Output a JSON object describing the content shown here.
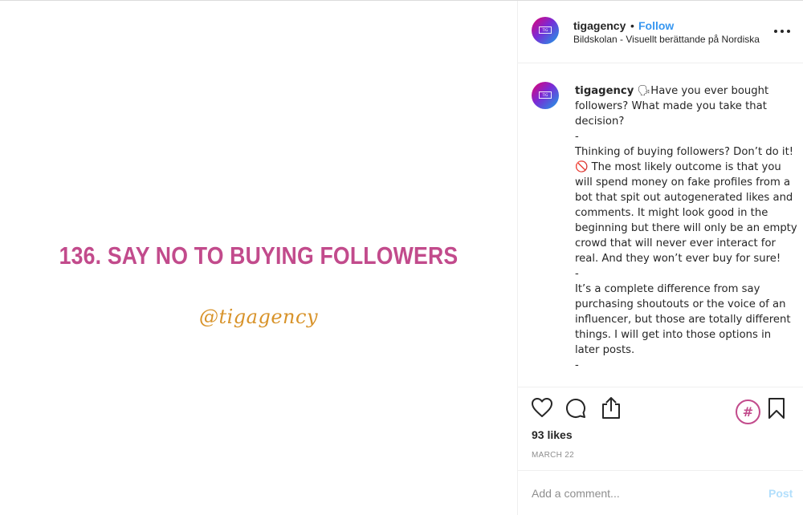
{
  "post": {
    "media": {
      "title": "136. SAY NO TO BUYING FOLLOWERS",
      "handle": "@tigagency"
    },
    "header": {
      "username": "tigagency",
      "separator": "•",
      "follow_label": "Follow",
      "location": "Bildskolan - Visuellt berättande på Nordiska"
    },
    "caption": {
      "username": "tigagency",
      "text": " 🗣Have you ever bought followers? What made you take that decision?\n-\nThinking of buying followers? Don’t do it! 🚫 The most likely outcome is that you will spend money on fake profiles from a bot that spit out autogenerated likes and comments. It might look good in the beginning but there will only be an empty crowd that will never ever interact for real. And they won’t ever buy for sure!\n-\nIt’s a complete difference from say purchasing shoutouts or the voice of an influencer, but those are totally different things. I will get into those options in later posts.\n-"
    },
    "actions": {
      "hashtag_symbol": "#",
      "likes": "93 likes",
      "date": "MARCH 22"
    },
    "comment": {
      "placeholder": "Add a comment...",
      "post_label": "Post"
    },
    "icons": [
      "heart-icon",
      "comment-icon",
      "share-icon",
      "hashtag-icon",
      "bookmark-icon",
      "more-options-icon"
    ],
    "colors": {
      "accent": "#3897f0",
      "title_pink": "#c24b8c",
      "handle_gold": "#d8932a",
      "post_disabled": "#b2dffc"
    }
  }
}
